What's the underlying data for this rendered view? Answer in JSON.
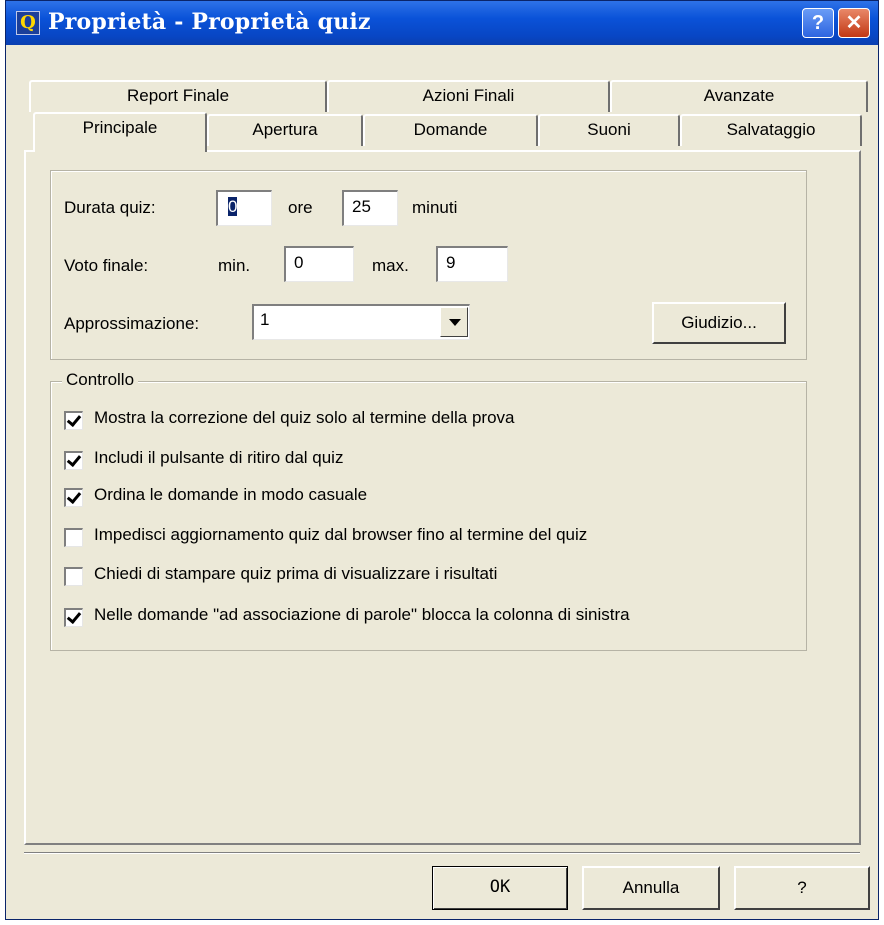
{
  "window": {
    "title": "Proprietà - Proprietà quiz",
    "app_icon": "Q",
    "help_glyph": "?",
    "close_glyph": "✕"
  },
  "tabs_back": [
    "Report Finale",
    "Azioni Finali",
    "Avanzate"
  ],
  "tabs_front": [
    "Principale",
    "Apertura",
    "Domande",
    "Suoni",
    "Salvataggio"
  ],
  "active_tab": "Principale",
  "durata": {
    "label": "Durata quiz:",
    "ore_value": "0",
    "ore_label": "ore",
    "minuti_value": "25",
    "minuti_label": "minuti"
  },
  "voto": {
    "label": "Voto finale:",
    "min_label": "min.",
    "min_value": "0",
    "max_label": "max.",
    "max_value": "9"
  },
  "approssimazione": {
    "label": "Approssimazione:",
    "value": "1"
  },
  "giudizio_button": "Giudizio...",
  "controllo": {
    "legend": "Controllo",
    "items": [
      {
        "label": "Mostra la correzione del quiz solo al termine della prova",
        "checked": true
      },
      {
        "label": "Includi il pulsante di ritiro dal quiz",
        "checked": true
      },
      {
        "label": "Ordina le domande in modo casuale",
        "checked": true
      },
      {
        "label": "Impedisci aggiornamento quiz dal browser fino al termine del quiz",
        "checked": false
      },
      {
        "label": "Chiedi di stampare quiz prima di visualizzare i risultati",
        "checked": false
      },
      {
        "label": "Nelle domande \"ad associazione di parole\" blocca la colonna di sinistra",
        "checked": true
      }
    ]
  },
  "buttons": {
    "ok": "OK",
    "cancel": "Annulla",
    "help": "?"
  }
}
